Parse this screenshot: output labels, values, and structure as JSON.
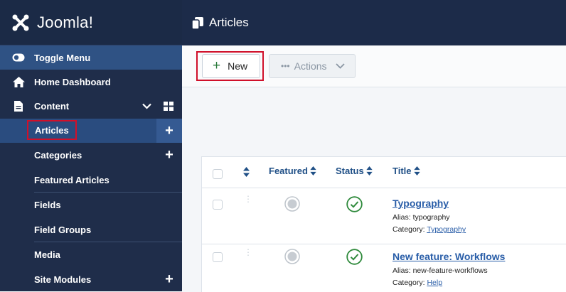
{
  "brand": {
    "logo_text": "Joomla!"
  },
  "sidebar": {
    "toggle_label": "Toggle Menu",
    "home_label": "Home Dashboard",
    "content_label": "Content",
    "items": [
      {
        "label": "Articles"
      },
      {
        "label": "Categories"
      },
      {
        "label": "Featured Articles"
      },
      {
        "label": "Fields"
      },
      {
        "label": "Field Groups"
      },
      {
        "label": "Media"
      },
      {
        "label": "Site Modules"
      }
    ]
  },
  "header": {
    "title": "Articles"
  },
  "toolbar": {
    "new_label": "New",
    "actions_label": "Actions"
  },
  "table": {
    "headers": {
      "featured": "Featured",
      "status": "Status",
      "title": "Title"
    },
    "alias_prefix": "Alias: ",
    "category_prefix": "Category: ",
    "rows": [
      {
        "title": "Typography",
        "alias": "typography",
        "category": "Typography"
      },
      {
        "title": "New feature: Workflows",
        "alias": "new-feature-workflows",
        "category": "Help"
      }
    ]
  },
  "colors": {
    "sidebar_bg": "#1f2d4a",
    "active_item": "#2a4c7f",
    "highlight_box": "#d0102a",
    "link": "#2a5ea8",
    "status_green": "#2f8a3c"
  }
}
